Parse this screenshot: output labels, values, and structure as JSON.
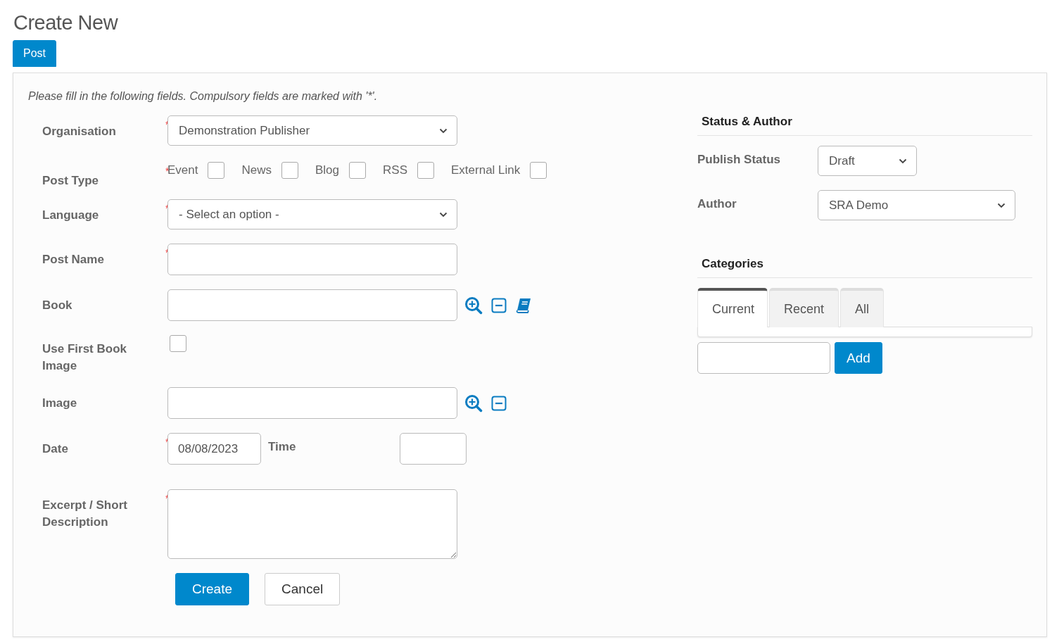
{
  "page": {
    "title": "Create New"
  },
  "tabs": [
    {
      "label": "Post",
      "selected": true
    }
  ],
  "form": {
    "intro": "Please fill in the following fields. Compulsory fields are marked with '*'.",
    "fields": [
      {
        "kind": "select",
        "label": "Organisation",
        "required_marker": "*",
        "value": "Demonstration Publisher"
      },
      {
        "kind": "checkboxes",
        "label": "Post Type",
        "required_marker": "*",
        "options": [
          {
            "label": "Event",
            "checked": false
          },
          {
            "label": "News",
            "checked": false
          },
          {
            "label": "Blog",
            "checked": false
          },
          {
            "label": "RSS",
            "checked": false
          },
          {
            "label": "External Link",
            "checked": false
          }
        ]
      },
      {
        "kind": "select",
        "label": "Language",
        "required_marker": "*",
        "value": "- Select an option -"
      },
      {
        "kind": "text",
        "label": "Post Name",
        "required_marker": "*"
      },
      {
        "kind": "lookup",
        "label": "Book",
        "book_picker": true
      },
      {
        "kind": "checkbox",
        "label": "Use First Book Image",
        "checked": false
      },
      {
        "kind": "lookup",
        "label": "Image",
        "book_picker": false
      },
      {
        "kind": "datetime",
        "label": "Date",
        "required_marker": "*",
        "value": "08/08/2023",
        "time_label": "Time"
      },
      {
        "kind": "textarea",
        "label": "Excerpt / Short Description",
        "required_marker": "*"
      }
    ],
    "buttons": [
      {
        "label": "Create",
        "kind": "primary"
      },
      {
        "label": "Cancel",
        "kind": "default"
      }
    ]
  },
  "status_author": {
    "title": "Status & Author",
    "fields": [
      {
        "label": "Publish Status",
        "value": "Draft"
      },
      {
        "label": "Author",
        "value": "SRA Demo"
      }
    ]
  },
  "categories": {
    "title": "Categories",
    "tabs": [
      {
        "label": "Current",
        "selected": true
      },
      {
        "label": "Recent",
        "selected": false
      },
      {
        "label": "All",
        "selected": false
      }
    ],
    "add_button": "Add"
  }
}
